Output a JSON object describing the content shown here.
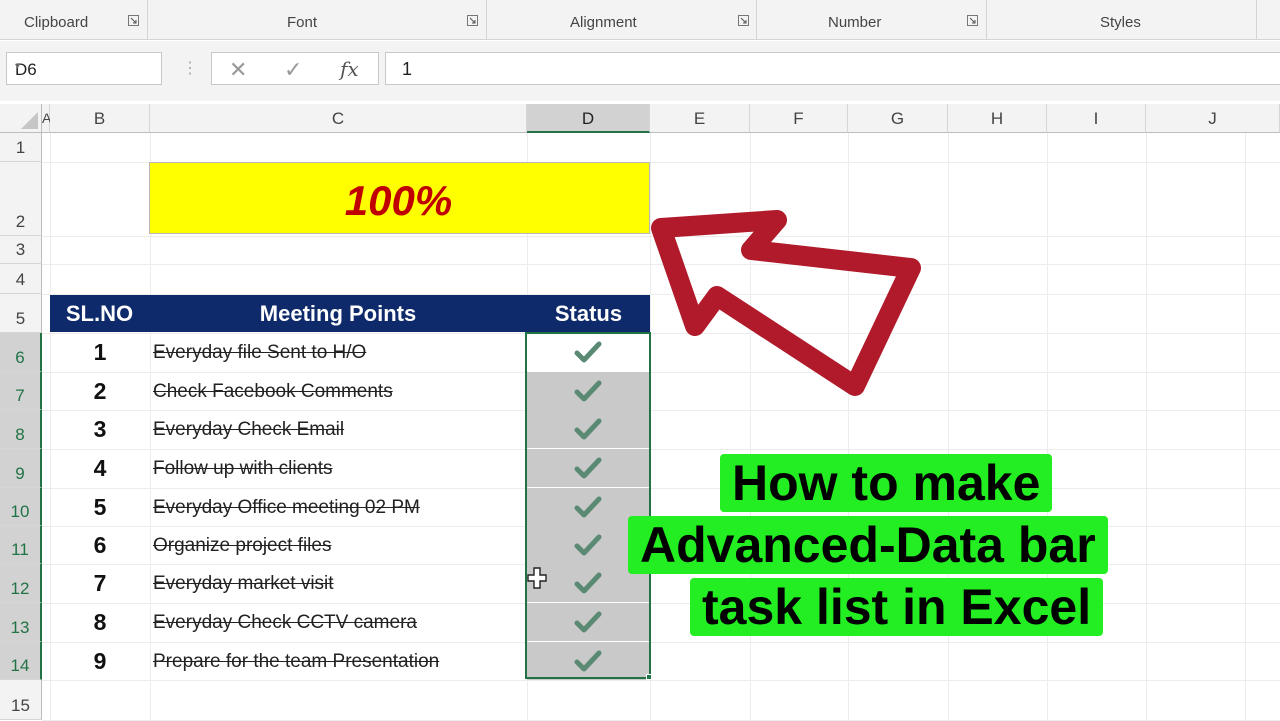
{
  "ribbon": {
    "groups": [
      {
        "label": "Clipboard"
      },
      {
        "label": "Font"
      },
      {
        "label": "Alignment"
      },
      {
        "label": "Number"
      },
      {
        "label": "Styles"
      }
    ]
  },
  "formula_bar": {
    "name_box": "D6",
    "formula": "1",
    "fx_label": "fx"
  },
  "columns": [
    "A",
    "B",
    "C",
    "D",
    "E",
    "F",
    "G",
    "H",
    "I",
    "J"
  ],
  "selected_column": "D",
  "rows": [
    "1",
    "2",
    "3",
    "4",
    "5",
    "6",
    "7",
    "8",
    "9",
    "10",
    "11",
    "12",
    "13",
    "14",
    "15"
  ],
  "progress": {
    "value": "100%",
    "fraction": 1.0
  },
  "table": {
    "headers": {
      "sl": "SL.NO",
      "points": "Meeting Points",
      "status": "Status"
    },
    "rows": [
      {
        "n": "1",
        "task": "Everyday file Sent to H/O",
        "done": true
      },
      {
        "n": "2",
        "task": "Check Facebook Comments",
        "done": true
      },
      {
        "n": "3",
        "task": "Everyday Check Email",
        "done": true
      },
      {
        "n": "4",
        "task": "Follow up with clients",
        "done": true
      },
      {
        "n": "5",
        "task": " Everyday Office meeting 02 PM",
        "done": true
      },
      {
        "n": "6",
        "task": "Organize project files",
        "done": true
      },
      {
        "n": "7",
        "task": "Everyday market visit",
        "done": true
      },
      {
        "n": "8",
        "task": "Everyday Check CCTV camera",
        "done": true
      },
      {
        "n": "9",
        "task": "Prepare for the team Presentation",
        "done": true
      }
    ]
  },
  "overlay": {
    "line1": "How to make",
    "line2": "Advanced-Data bar",
    "line3": "task list in Excel"
  },
  "colors": {
    "header_bg": "#0e2a6b",
    "progress_fill": "#ffff00",
    "progress_text": "#c00000",
    "check": "#5a8a73",
    "selection": "#217346",
    "overlay_bg": "#22ee22",
    "arrow": "#b01a2a"
  },
  "icons": [
    "dialog-launcher-icon",
    "dropdown-icon",
    "cancel-x-icon",
    "enter-check-icon",
    "fx-icon",
    "checkmark-icon",
    "move-cursor-icon",
    "arrow-icon"
  ]
}
